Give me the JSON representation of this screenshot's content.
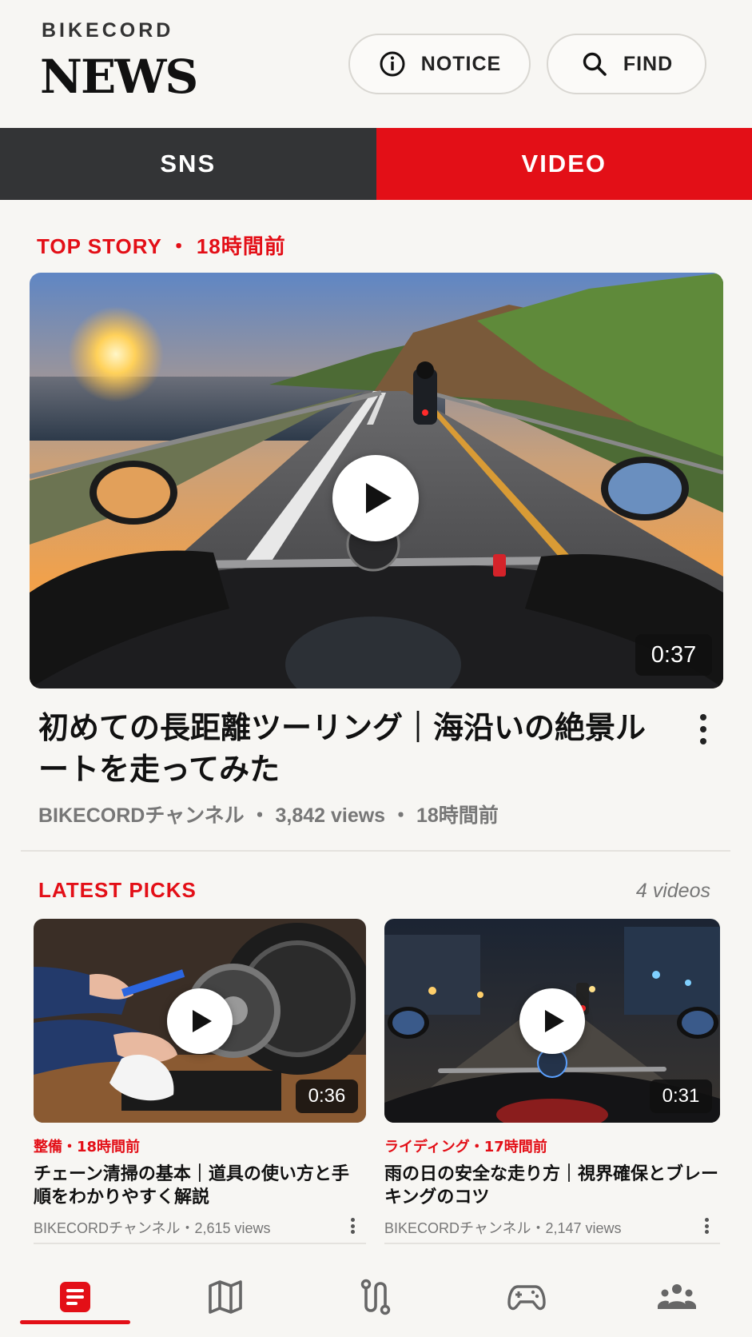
{
  "header": {
    "brand_top": "BIKECORD",
    "brand_main": "NEWS",
    "notice_label": "NOTICE",
    "find_label": "FIND"
  },
  "tabs": [
    {
      "label": "SNS",
      "active": false
    },
    {
      "label": "VIDEO",
      "active": true
    }
  ],
  "top_story": {
    "heading": "TOP STORY ・ 18時間前",
    "duration": "0:37",
    "title": "初めての長距離ツーリング｜海沿いの絶景ルートを走ってみた",
    "meta": "BIKECORDチャンネル ・ 3,842 views ・ 18時間前"
  },
  "latest": {
    "heading": "LATEST PICKS",
    "count": "4 videos",
    "cards": [
      {
        "category": "整備・18時間前",
        "title": "チェーン清掃の基本｜道具の使い方と手順をわかりやすく解説",
        "duration": "0:36",
        "meta": "BIKECORDチャンネル・2,615 views"
      },
      {
        "category": "ライディング・17時間前",
        "title": "雨の日の安全な走り方｜視界確保とブレーキングのコツ",
        "duration": "0:31",
        "meta": "BIKECORDチャンネル・2,147 views"
      }
    ]
  },
  "bottom_nav": [
    {
      "icon": "article-icon",
      "active": true
    },
    {
      "icon": "map-icon",
      "active": false
    },
    {
      "icon": "route-icon",
      "active": false
    },
    {
      "icon": "gamepad-icon",
      "active": false
    },
    {
      "icon": "community-icon",
      "active": false
    }
  ],
  "colors": {
    "accent": "#e30f17",
    "dark_tab": "#333436",
    "background": "#f7f6f3"
  }
}
